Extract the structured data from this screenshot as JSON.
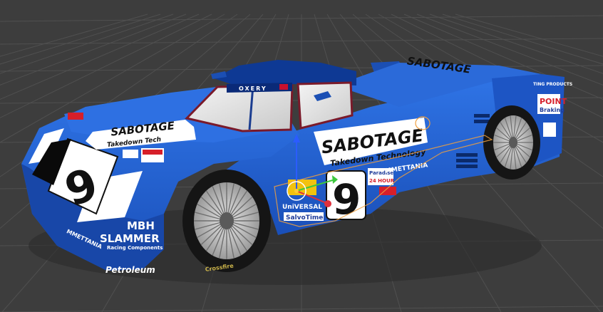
{
  "scene": {
    "background_color": "#3d3d3d",
    "grid_color": "#505050",
    "car_body_color": "#1f5fd0",
    "car_dark_color": "#0a2a78",
    "stripe_color": "#ffffff"
  },
  "car": {
    "race_number": "9",
    "roof_brand": "OXERY",
    "main_sponsor": "SABOTAGE",
    "main_sponsor_tagline": "Takedown Technology",
    "hood_sponsor": "SABOTAGE",
    "hood_sponsor_tagline": "Takedown Tech",
    "rear_sponsor": "SABOTAGE",
    "rear_panel_text_1": "TING PRODUCTS",
    "rear_panel_text_2": "POINT",
    "rear_panel_text_3": "Braking",
    "side_sponsor_1": "MMETTANIA",
    "side_sponsor_2": "Paradise",
    "side_sponsor_3": "24 HOUR",
    "side_sponsor_4": "UniVERSAL",
    "side_sponsor_5": "SalvoTime",
    "front_sponsor_1": "MBH",
    "front_sponsor_2": "SLAMMER",
    "front_sponsor_3": "Racing Components",
    "front_sponsor_4": "Petroleum",
    "front_sponsor_5": "MMETTANIA",
    "tire_text": "Crossfire"
  },
  "gizmo": {
    "x_axis_color": "#e0303c",
    "y_axis_color": "#3cc83c",
    "z_axis_color": "#2b5cff",
    "selection_color": "#f0a040"
  }
}
